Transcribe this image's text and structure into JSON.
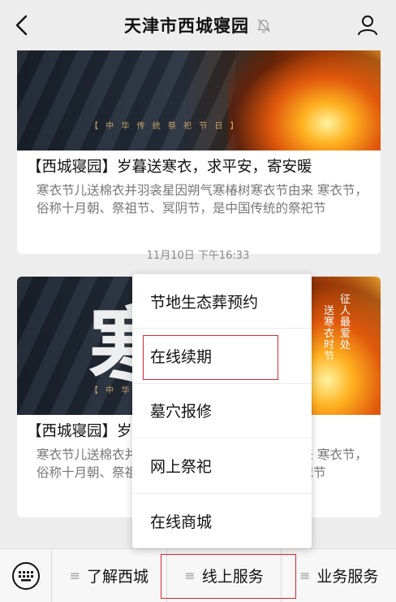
{
  "header": {
    "title": "天津市西城寝园",
    "back_icon": "back-chevron-icon",
    "mute_icon": "bell-muted-icon",
    "profile_icon": "person-icon"
  },
  "cards": [
    {
      "banner_caption": "【 中 华 传 统 祭 祀 节 日 】",
      "title": "【西城寝园】岁暮送寒衣，求平安，寄安暖",
      "desc": "寒衣节儿送棉衣并羽衾星因朔气寒椿树寒衣节由来    寒衣节，俗称十月朝、祭祖节、冥阴节，是中国传统的祭祀节"
    },
    {
      "banner_caption": "【 中 华 传 统 祭 祀 节 日 】",
      "banner_big": "寒",
      "banner_vertical_1": "征人最爱处",
      "banner_vertical_2": "送寒衣时节",
      "title": "【西城寝园】岁暮送寒衣，求平安，寄安暖",
      "desc": "寒衣节儿送棉衣并羽衾星因朔气寒椿树寒衣节由来    寒衣节，俗称十月朝、祭祖节、冥阴节，是中国传统的祭祀节"
    }
  ],
  "timestamp": "11月10日 下午16:33",
  "popup_menu": {
    "items": [
      "节地生态葬预约",
      "在线续期",
      "墓穴报修",
      "网上祭祀",
      "在线商城"
    ]
  },
  "bottom_menu": {
    "keyboard_icon": "keyboard-icon",
    "items": [
      "了解西城",
      "线上服务",
      "业务服务"
    ]
  },
  "colors": {
    "background": "#ededed",
    "highlight_border": "#d9262d",
    "card_bg": "#ffffff"
  }
}
